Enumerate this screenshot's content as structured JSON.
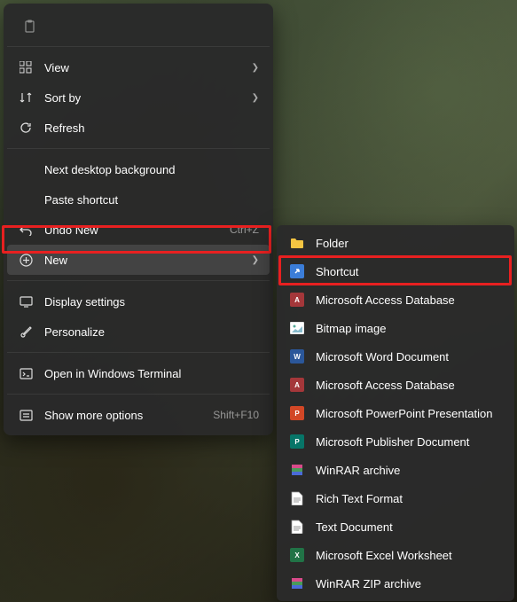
{
  "contextMenu": {
    "items": {
      "view": {
        "label": "View"
      },
      "sortBy": {
        "label": "Sort by"
      },
      "refresh": {
        "label": "Refresh"
      },
      "nextDesktop": {
        "label": "Next desktop background"
      },
      "pasteShortcut": {
        "label": "Paste shortcut"
      },
      "undoNew": {
        "label": "Undo New",
        "shortcut": "Ctrl+Z"
      },
      "new": {
        "label": "New"
      },
      "displaySettings": {
        "label": "Display settings"
      },
      "personalize": {
        "label": "Personalize"
      },
      "openTerminal": {
        "label": "Open in Windows Terminal"
      },
      "showMore": {
        "label": "Show more options",
        "shortcut": "Shift+F10"
      }
    }
  },
  "submenu": {
    "items": [
      {
        "label": "Folder",
        "iconColor": "#f5c542",
        "iconType": "folder"
      },
      {
        "label": "Shortcut",
        "iconColor": "#3b7dd8",
        "iconType": "shortcut"
      },
      {
        "label": "Microsoft Access Database",
        "iconColor": "#a4373a",
        "iconText": "A"
      },
      {
        "label": "Bitmap image",
        "iconColor": "#e8e8e8",
        "iconType": "image"
      },
      {
        "label": "Microsoft Word Document",
        "iconColor": "#2b579a",
        "iconText": "W"
      },
      {
        "label": "Microsoft Access Database",
        "iconColor": "#a4373a",
        "iconText": "A"
      },
      {
        "label": "Microsoft PowerPoint Presentation",
        "iconColor": "#d24726",
        "iconText": "P"
      },
      {
        "label": "Microsoft Publisher Document",
        "iconColor": "#077568",
        "iconText": "P"
      },
      {
        "label": "WinRAR archive",
        "iconColor": "#8b4a9e",
        "iconType": "rar"
      },
      {
        "label": "Rich Text Format",
        "iconColor": "#4a8fd8",
        "iconType": "doc"
      },
      {
        "label": "Text Document",
        "iconColor": "#e8e8e8",
        "iconType": "doc"
      },
      {
        "label": "Microsoft Excel Worksheet",
        "iconColor": "#217346",
        "iconText": "X"
      },
      {
        "label": "WinRAR ZIP archive",
        "iconColor": "#8b4a9e",
        "iconType": "rar"
      }
    ]
  }
}
